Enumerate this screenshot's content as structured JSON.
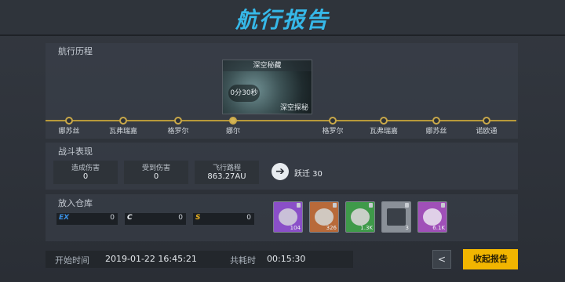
{
  "header": {
    "title": "航行报告"
  },
  "voyage": {
    "section_title": "航行历程",
    "card": {
      "name": "深空秘藏",
      "timer": "0分30秒",
      "tag": "深空探秘"
    },
    "nodes": [
      {
        "label": "娜苏丝",
        "active": false
      },
      {
        "label": "瓦弗瑞嘉",
        "active": false
      },
      {
        "label": "格罗尔",
        "active": false
      },
      {
        "label": "娜尔",
        "active": true
      },
      {
        "label": "格罗尔",
        "active": false
      },
      {
        "label": "瓦弗瑞嘉",
        "active": false
      },
      {
        "label": "娜苏丝",
        "active": false
      },
      {
        "label": "诺欧通",
        "active": false
      }
    ],
    "route_color": "#b89a3a"
  },
  "battle": {
    "section_title": "战斗表现",
    "stats": [
      {
        "label": "造成伤害",
        "value": "0"
      },
      {
        "label": "受到伤害",
        "value": "0"
      },
      {
        "label": "飞行路程",
        "value": "863.27AU"
      }
    ],
    "jump": {
      "icon": "arrow-right-icon",
      "label": "跃迁 30"
    }
  },
  "storage": {
    "section_title": "放入仓库",
    "currencies": [
      {
        "icon_text": "EX",
        "icon_color": "#3a8ee0",
        "value": "0"
      },
      {
        "icon_text": "C",
        "icon_color": "#e8ecf0",
        "value": "0"
      },
      {
        "icon_text": "S",
        "icon_color": "#e8b020",
        "value": "0"
      }
    ],
    "items": [
      {
        "count": "104",
        "bg": "#8a4fc8",
        "art": "#c9c0d8"
      },
      {
        "count": "326",
        "bg": "#b86a3a",
        "art": "#d0c8c0"
      },
      {
        "count": "1.3K",
        "bg": "#3f9a4a",
        "art": "#c8cfc8"
      },
      {
        "count": "3",
        "bg": "#8a9098",
        "art": "#3a4048"
      },
      {
        "count": "6.1K",
        "bg": "#a050b8",
        "art": "#e0d0e8"
      }
    ]
  },
  "footer": {
    "start_label": "开始时间",
    "start_value": "2019-01-22 16:45:21",
    "duration_label": "共耗时",
    "duration_value": "00:15:30",
    "share_icon": "share-icon",
    "collect_label": "收起报告",
    "accent": "#f1b500"
  }
}
